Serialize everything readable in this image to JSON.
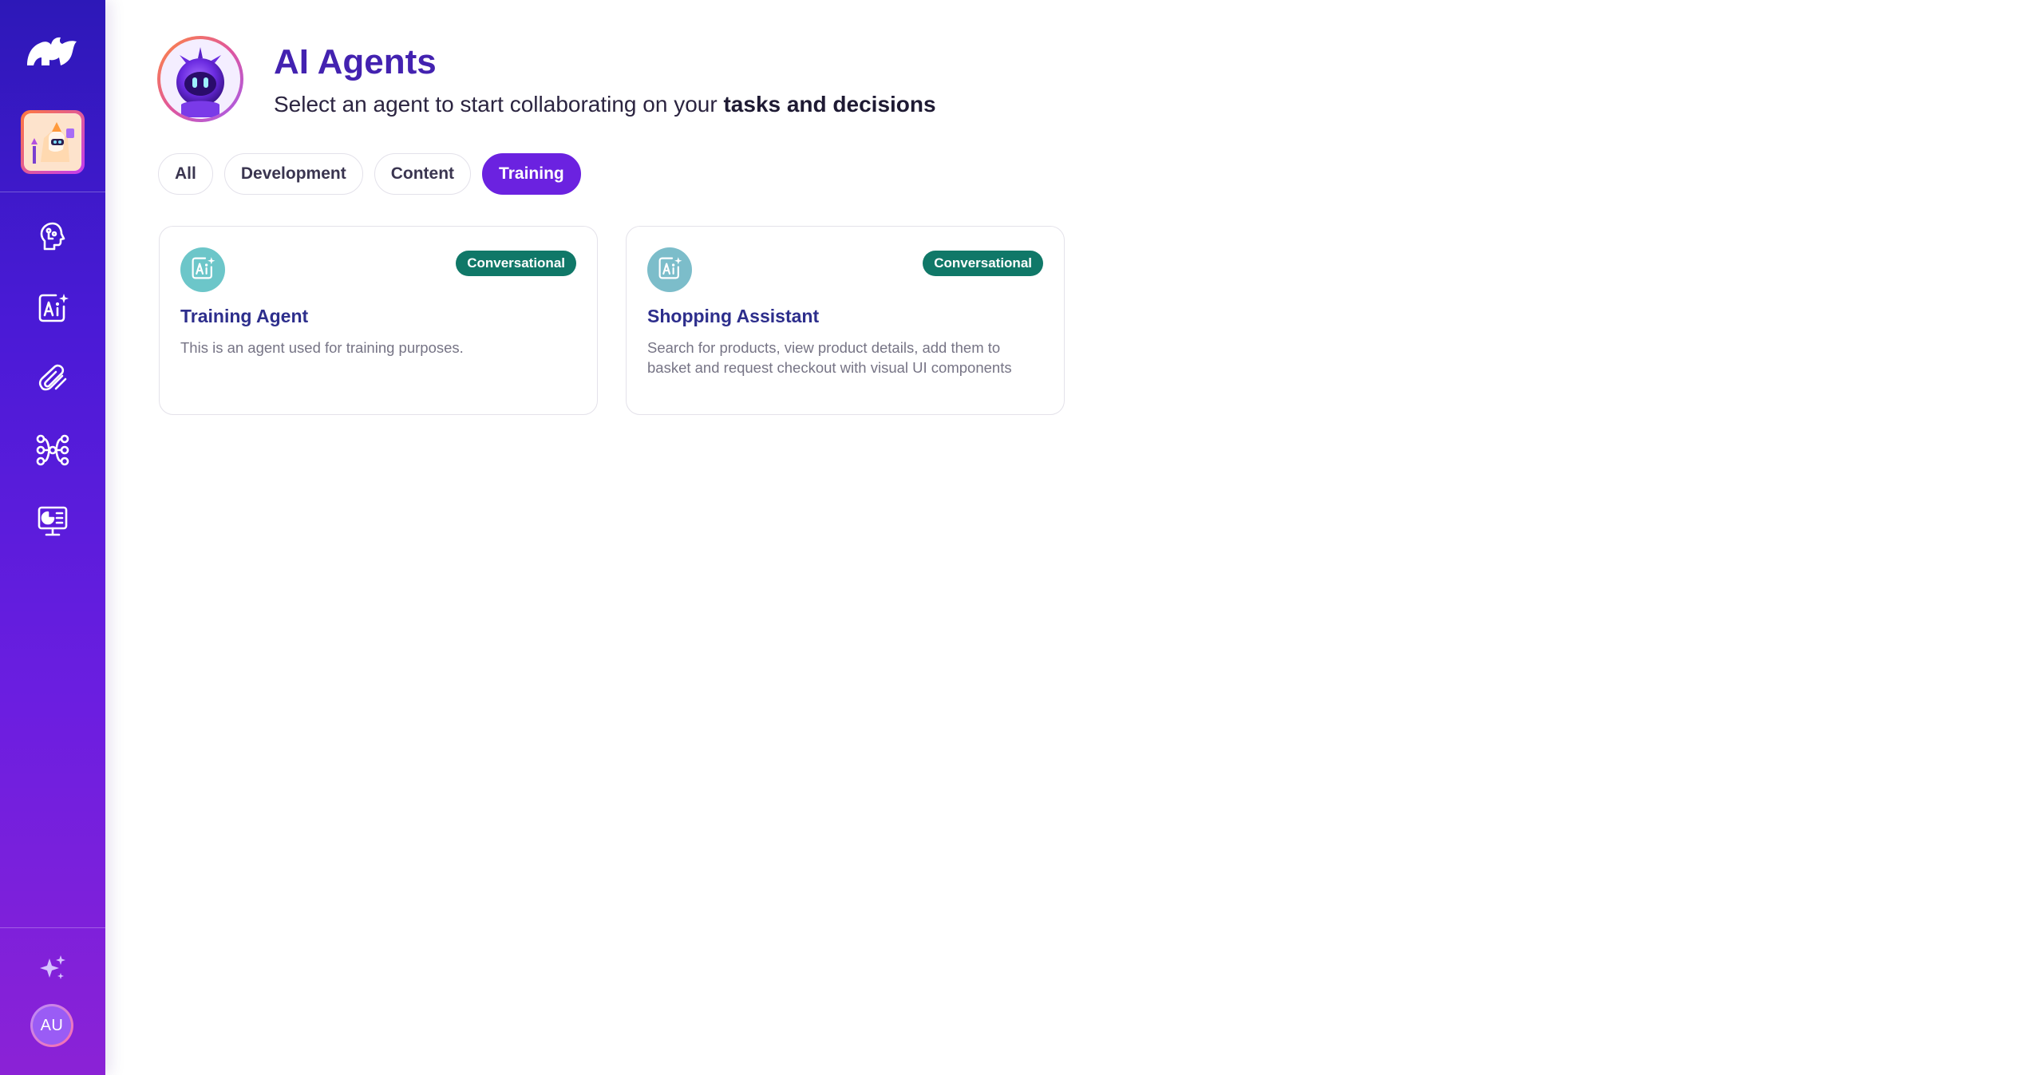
{
  "sidebar": {
    "logo_icon": "rhino-logo-icon",
    "workspace_icon": "workspace-thumbnail",
    "nav": [
      {
        "icon": "brain-circuit-icon"
      },
      {
        "icon": "ai-text-icon"
      },
      {
        "icon": "paperclip-icon"
      },
      {
        "icon": "workflow-nodes-icon"
      },
      {
        "icon": "presentation-chart-icon"
      }
    ],
    "sparkle_icon": "sparkles-icon",
    "avatar_initials": "AU"
  },
  "header": {
    "title": "AI Agents",
    "subtitle_prefix": "Select an agent to start collaborating on your ",
    "subtitle_emphasis": "tasks and decisions"
  },
  "filters": {
    "tabs": [
      "All",
      "Development",
      "Content",
      "Training"
    ],
    "active": "Training"
  },
  "agents": [
    {
      "name": "Training Agent",
      "badge": "Conversational",
      "description": "This is an agent used for training purposes.",
      "icon": "ai-text-icon"
    },
    {
      "name": "Shopping Assistant",
      "badge": "Conversational",
      "description": "Search for products, view product details, add them to basket and request checkout with visual UI components",
      "icon": "ai-text-icon"
    }
  ],
  "colors": {
    "accent": "#6b22e0",
    "title": "#4322b0",
    "badge": "#107868",
    "card_title": "#2d2e8c",
    "agent_icon_bg": "#6cc6c9"
  }
}
